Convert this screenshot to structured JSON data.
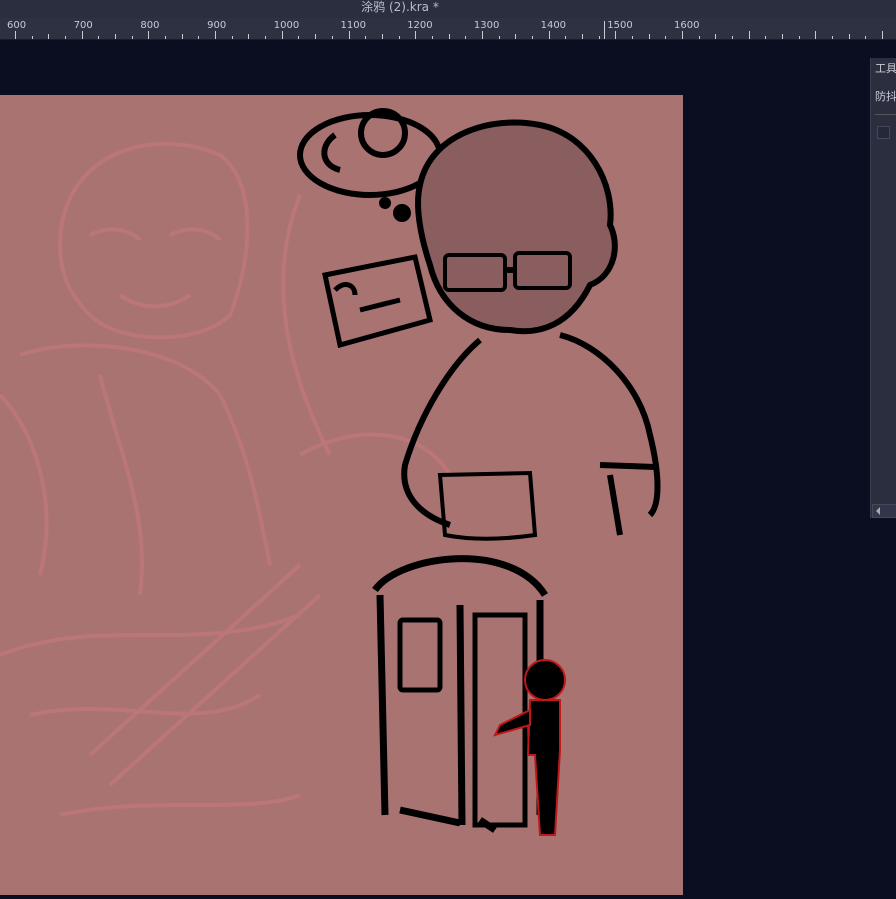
{
  "window": {
    "title": "涂鸦 (2).kra *"
  },
  "ruler": {
    "labels": [
      "600",
      "700",
      "800",
      "900",
      "1000",
      "1100",
      "1200",
      "1300",
      "1400",
      "1500",
      "1600"
    ]
  },
  "docker": {
    "title": "工具",
    "section": "防抖"
  },
  "colors": {
    "canvas": "#a87371",
    "background": "#0b0d20",
    "ink": "#000000",
    "sketch": "#c0777a",
    "accent_figure": "#c01818"
  }
}
